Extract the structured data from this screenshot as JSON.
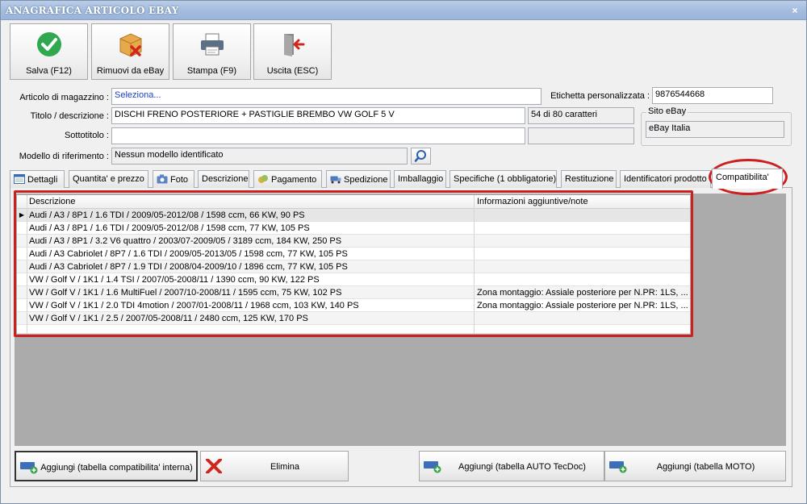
{
  "window": {
    "title": "ANAGRAFICA ARTICOLO EBAY",
    "close": "×"
  },
  "toolbar": {
    "save": "Salva (F12)",
    "remove": "Rimuovi da eBay",
    "print": "Stampa (F9)",
    "exit": "Uscita (ESC)"
  },
  "form": {
    "article_label": "Articolo di magazzino :",
    "article_value": "Seleziona...",
    "title_label": "Titolo / descrizione :",
    "title_value": "DISCHI FRENO POSTERIORE + PASTIGLIE BREMBO VW GOLF 5 V",
    "char_count": "54 di 80 caratteri",
    "subtitle_label": "Sottotitolo :",
    "subtitle_value": "",
    "model_label": "Modello di riferimento :",
    "model_value": "Nessun modello identificato",
    "custom_label": "Etichetta personalizzata :",
    "custom_value": "9876544668",
    "site_group": "Sito eBay",
    "site_value": "eBay Italia"
  },
  "tabs": [
    {
      "label": "Dettagli"
    },
    {
      "label": "Quantita' e prezzo"
    },
    {
      "label": "Foto"
    },
    {
      "label": "Descrizione"
    },
    {
      "label": "Pagamento"
    },
    {
      "label": "Spedizione"
    },
    {
      "label": "Imballaggio"
    },
    {
      "label": "Specifiche (1 obbligatorie)"
    },
    {
      "label": "Restituzione"
    },
    {
      "label": "Identificatori prodotto"
    },
    {
      "label": "Compatibilita'"
    }
  ],
  "grid": {
    "col_desc": "Descrizione",
    "col_info": "Informazioni aggiuntive/note",
    "current_marker": "▶",
    "rows": [
      {
        "desc": "Audi / A3 / 8P1 / 1.6 TDI / 2009/05-2012/08 / 1598 ccm, 66 KW, 90 PS",
        "info": ""
      },
      {
        "desc": "Audi / A3 / 8P1 / 1.6 TDI / 2009/05-2012/08 / 1598 ccm, 77 KW, 105 PS",
        "info": ""
      },
      {
        "desc": "Audi / A3 / 8P1 / 3.2 V6 quattro / 2003/07-2009/05 / 3189 ccm, 184 KW, 250 PS",
        "info": ""
      },
      {
        "desc": "Audi / A3 Cabriolet / 8P7 / 1.6 TDI / 2009/05-2013/05 / 1598 ccm, 77 KW, 105 PS",
        "info": ""
      },
      {
        "desc": "Audi / A3 Cabriolet / 8P7 / 1.9 TDI / 2008/04-2009/10 / 1896 ccm, 77 KW, 105 PS",
        "info": ""
      },
      {
        "desc": "VW / Golf V / 1K1 / 1.4 TSI / 2007/05-2008/11 / 1390 ccm, 90 KW, 122 PS",
        "info": ""
      },
      {
        "desc": "VW / Golf V / 1K1 / 1.6 MultiFuel / 2007/10-2008/11 / 1595 ccm, 75 KW, 102 PS",
        "info": "Zona montaggio: Assiale posteriore per N.PR: 1LS, ..."
      },
      {
        "desc": "VW / Golf V / 1K1 / 2.0 TDI 4motion / 2007/01-2008/11 / 1968 ccm, 103 KW, 140 PS",
        "info": "Zona montaggio: Assiale posteriore per N.PR: 1LS, ..."
      },
      {
        "desc": "VW / Golf V / 1K1 / 2.5 / 2007/05-2008/11 / 2480 ccm, 125 KW, 170 PS",
        "info": ""
      }
    ]
  },
  "buttons": {
    "add_internal": "Aggiungi (tabella compatibilita' interna)",
    "delete": "Elimina",
    "add_tecdoc": "Aggiungi (tabella AUTO TecDoc)",
    "add_moto": "Aggiungi (tabella MOTO)"
  }
}
